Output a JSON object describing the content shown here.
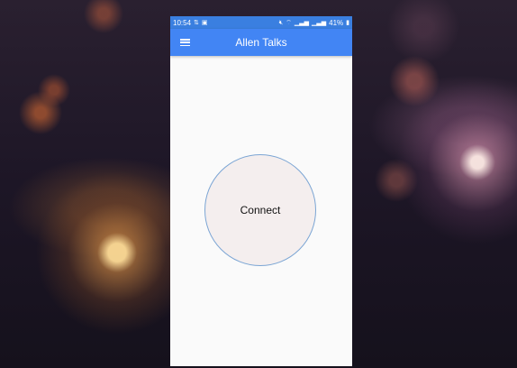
{
  "status_bar": {
    "time": "10:54",
    "left_icons": [
      "data-transfer-icon",
      "gallery-notification-icon"
    ],
    "right_icons": [
      "mute-icon",
      "wifi-icon",
      "signal-icon",
      "lte-signal-icon"
    ],
    "battery_percent": "41%"
  },
  "app_bar": {
    "title": "Allen Talks",
    "menu_icon": "hamburger-menu-icon",
    "color": "#4285f4"
  },
  "main": {
    "connect_label": "Connect"
  }
}
